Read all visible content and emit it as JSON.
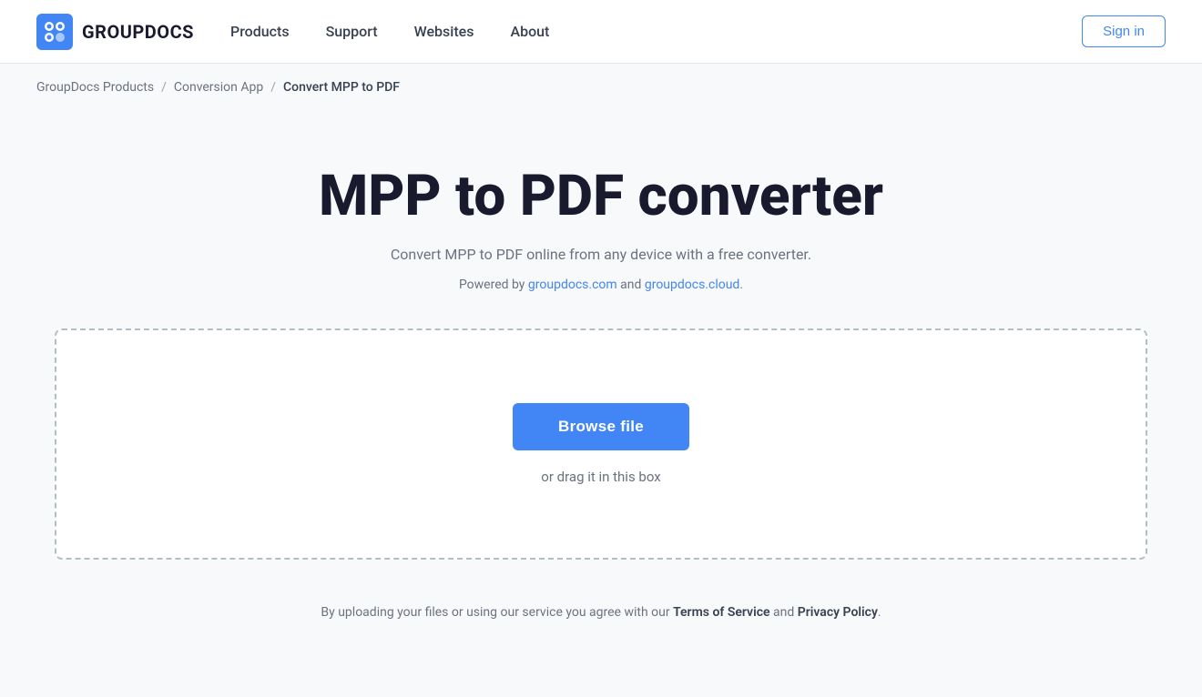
{
  "logo": {
    "text": "GROUPDOCS"
  },
  "nav": {
    "items": [
      {
        "label": "Products",
        "href": "#"
      },
      {
        "label": "Support",
        "href": "#"
      },
      {
        "label": "Websites",
        "href": "#"
      },
      {
        "label": "About",
        "href": "#"
      }
    ],
    "sign_in_label": "Sign in"
  },
  "breadcrumb": {
    "item1": "GroupDocs Products",
    "item2": "Conversion App",
    "item3": "Convert MPP to PDF",
    "separator": "/"
  },
  "hero": {
    "title": "MPP to PDF converter",
    "subtitle": "Convert MPP to PDF online from any device with a free converter.",
    "powered_prefix": "Powered by ",
    "powered_link1": "groupdocs.com",
    "powered_middle": " and ",
    "powered_link2": "groupdocs.cloud",
    "powered_suffix": "."
  },
  "upload": {
    "browse_label": "Browse file",
    "drag_label": "or drag it in this box"
  },
  "footer_note": {
    "prefix": "By uploading your files or using our service you agree with our ",
    "tos_label": "Terms of Service",
    "middle": " and ",
    "privacy_label": "Privacy Policy",
    "suffix": "."
  }
}
